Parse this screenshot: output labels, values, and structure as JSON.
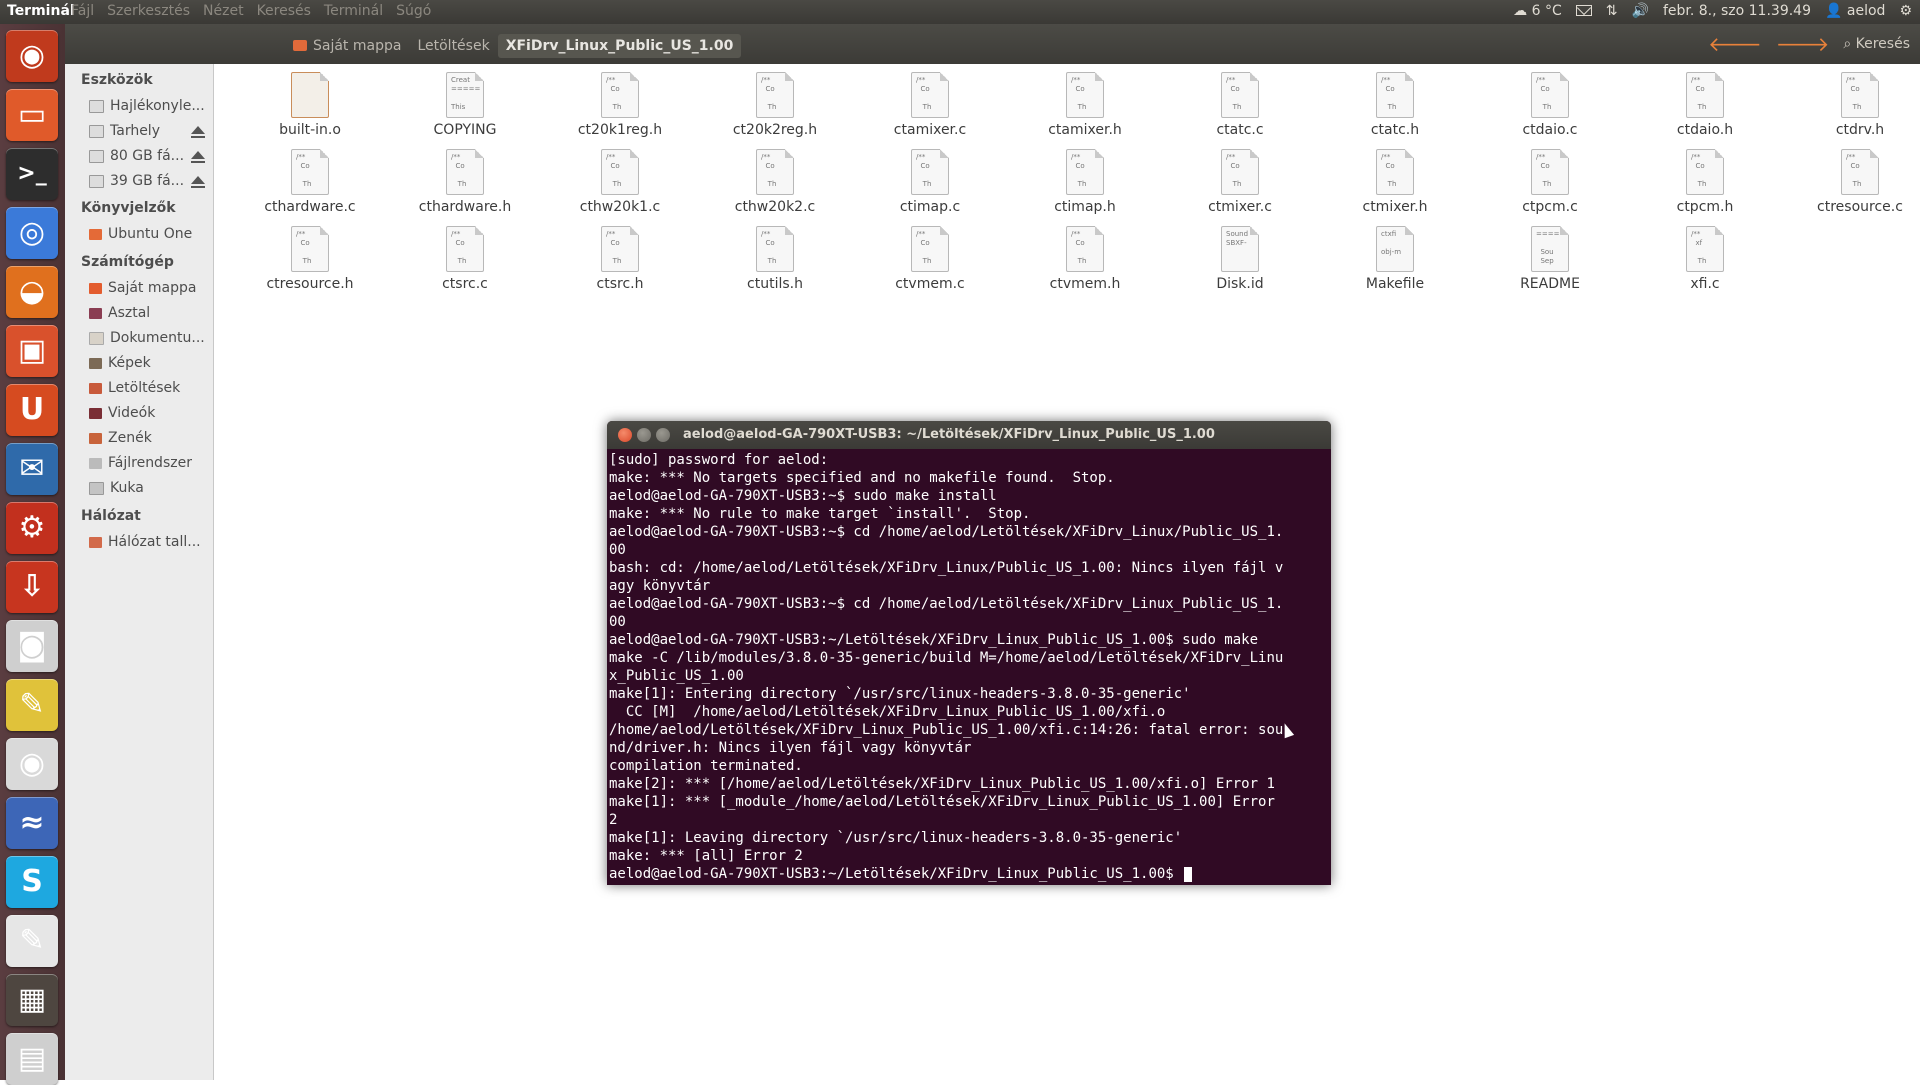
{
  "topbar": {
    "app_name": "Terminál",
    "menu": [
      "Fájl",
      "Szerkesztés",
      "Nézet",
      "Keresés",
      "Terminál",
      "Súgó"
    ],
    "weather": "6 °C",
    "datetime": "febr. 8., szo 11.39.49",
    "user": "aelod"
  },
  "launcher": {
    "items": [
      {
        "name": "dash-home",
        "color": "#c03a1d",
        "glyph": "◉"
      },
      {
        "name": "files",
        "color": "#e05a2a",
        "glyph": "▭"
      },
      {
        "name": "terminal",
        "color": "#2d2d2d",
        "glyph": ">_"
      },
      {
        "name": "chrome",
        "color": "#3b7ad9",
        "glyph": "◎"
      },
      {
        "name": "firefox",
        "color": "#e0701e",
        "glyph": "◒"
      },
      {
        "name": "software-center",
        "color": "#d9512c",
        "glyph": "▣"
      },
      {
        "name": "ubuntu-one",
        "color": "#d64b20",
        "glyph": "U"
      },
      {
        "name": "thunderbird",
        "color": "#2f6aaa",
        "glyph": "✉"
      },
      {
        "name": "system-settings",
        "color": "#c2301e",
        "glyph": "⚙"
      },
      {
        "name": "installer",
        "color": "#c7351f",
        "glyph": "⇩"
      },
      {
        "name": "camera",
        "color": "#cfcfcf",
        "glyph": "◙"
      },
      {
        "name": "sticky-notes",
        "color": "#e0c23a",
        "glyph": "✎"
      },
      {
        "name": "speaker",
        "color": "#d9d9d9",
        "glyph": "◉"
      },
      {
        "name": "messenger",
        "color": "#3d66b7",
        "glyph": "≈"
      },
      {
        "name": "skype",
        "color": "#1ea8e0",
        "glyph": "S"
      },
      {
        "name": "text-editor",
        "color": "#e6e6e6",
        "glyph": "✎"
      },
      {
        "name": "workspaces",
        "color": "#4e4640",
        "glyph": "▦"
      },
      {
        "name": "trash",
        "color": "#cfcfcf",
        "glyph": "▤"
      }
    ]
  },
  "nautilus": {
    "breadcrumb": [
      "Saját mappa",
      "Letöltések",
      "XFiDrv_Linux_Public_US_1.00"
    ],
    "search_label": "Keresés",
    "sidebar": {
      "devices_header": "Eszközök",
      "devices": [
        "Hajlékonyle...",
        "Tarhely",
        "80 GB fá...",
        "39 GB fá..."
      ],
      "bookmarks_header": "Könyvjelzők",
      "bookmarks": [
        "Ubuntu One"
      ],
      "computer_header": "Számítógép",
      "computer": [
        "Saját mappa",
        "Asztal",
        "Dokumentu...",
        "Képek",
        "Letöltések",
        "Videók",
        "Zenék",
        "Fájlrendszer",
        "Kuka"
      ],
      "network_header": "Hálózat",
      "network": [
        "Hálózat tall..."
      ]
    },
    "files": [
      {
        "name": "built-in.o",
        "preview": ""
      },
      {
        "name": "COPYING",
        "preview": "Creat\n=====\n\nThis"
      },
      {
        "name": "ct20k1reg.h",
        "preview": "/**  \n  Co\n\n   Th"
      },
      {
        "name": "ct20k2reg.h",
        "preview": "/**  \n  Co\n\n   Th"
      },
      {
        "name": "ctamixer.c",
        "preview": "/**  \n  Co\n\n   Th"
      },
      {
        "name": "ctamixer.h",
        "preview": "/**  \n  Co\n\n   Th"
      },
      {
        "name": "ctatc.c",
        "preview": "/**  \n  Co\n\n   Th"
      },
      {
        "name": "ctatc.h",
        "preview": "/**  \n  Co\n\n   Th"
      },
      {
        "name": "ctdaio.c",
        "preview": "/**  \n  Co\n\n   Th"
      },
      {
        "name": "ctdaio.h",
        "preview": "/**  \n  Co\n\n   Th"
      },
      {
        "name": "ctdrv.h",
        "preview": "/**  \n  Co\n\n   Th"
      },
      {
        "name": "cthardware.c",
        "preview": "/**  \n  Co\n\n   Th"
      },
      {
        "name": "cthardware.h",
        "preview": "/**  \n  Co\n\n   Th"
      },
      {
        "name": "cthw20k1.c",
        "preview": "/**  \n  Co\n\n   Th"
      },
      {
        "name": "cthw20k2.c",
        "preview": "/**  \n  Co\n\n   Th"
      },
      {
        "name": "ctimap.c",
        "preview": "/**  \n  Co\n\n   Th"
      },
      {
        "name": "ctimap.h",
        "preview": "/**  \n  Co\n\n   Th"
      },
      {
        "name": "ctmixer.c",
        "preview": "/**  \n  Co\n\n   Th"
      },
      {
        "name": "ctmixer.h",
        "preview": "/**  \n  Co\n\n   Th"
      },
      {
        "name": "ctpcm.c",
        "preview": "/**  \n  Co\n\n   Th"
      },
      {
        "name": "ctpcm.h",
        "preview": "/**  \n  Co\n\n   Th"
      },
      {
        "name": "ctresource.c",
        "preview": "/**  \n  Co\n\n   Th"
      },
      {
        "name": "ctresource.h",
        "preview": "/**  \n  Co\n\n   Th"
      },
      {
        "name": "ctsrc.c",
        "preview": "/**  \n  Co\n\n   Th"
      },
      {
        "name": "ctsrc.h",
        "preview": "/**  \n  Co\n\n   Th"
      },
      {
        "name": "ctutils.h",
        "preview": "/**  \n  Co\n\n   Th"
      },
      {
        "name": "ctvmem.c",
        "preview": "/**  \n  Co\n\n   Th"
      },
      {
        "name": "ctvmem.h",
        "preview": "/**  \n  Co\n\n   Th"
      },
      {
        "name": "Disk.id",
        "preview": "Sound\nSBXF-"
      },
      {
        "name": "Makefile",
        "preview": "ctxfi\n\nobj-m"
      },
      {
        "name": "README",
        "preview": "=====\n\n  Sou\n  Sep"
      },
      {
        "name": "xfi.c",
        "preview": "/**  \n  xf\n\n   Th"
      }
    ]
  },
  "terminal": {
    "title": "aelod@aelod-GA-790XT-USB3: ~/Letöltések/XFiDrv_Linux_Public_US_1.00",
    "lines": [
      "[sudo] password for aelod:",
      "make: *** No targets specified and no makefile found.  Stop.",
      "aelod@aelod-GA-790XT-USB3:~$ sudo make install",
      "make: *** No rule to make target `install'.  Stop.",
      "aelod@aelod-GA-790XT-USB3:~$ cd /home/aelod/Letöltések/XFiDrv_Linux/Public_US_1.",
      "00",
      "bash: cd: /home/aelod/Letöltések/XFiDrv_Linux/Public_US_1.00: Nincs ilyen fájl v",
      "agy könyvtár",
      "aelod@aelod-GA-790XT-USB3:~$ cd /home/aelod/Letöltések/XFiDrv_Linux_Public_US_1.",
      "00",
      "aelod@aelod-GA-790XT-USB3:~/Letöltések/XFiDrv_Linux_Public_US_1.00$ sudo make",
      "make -C /lib/modules/3.8.0-35-generic/build M=/home/aelod/Letöltések/XFiDrv_Linu",
      "x_Public_US_1.00",
      "make[1]: Entering directory `/usr/src/linux-headers-3.8.0-35-generic'",
      "  CC [M]  /home/aelod/Letöltések/XFiDrv_Linux_Public_US_1.00/xfi.o",
      "/home/aelod/Letöltések/XFiDrv_Linux_Public_US_1.00/xfi.c:14:26: fatal error: sou",
      "nd/driver.h: Nincs ilyen fájl vagy könyvtár",
      "compilation terminated.",
      "make[2]: *** [/home/aelod/Letöltések/XFiDrv_Linux_Public_US_1.00/xfi.o] Error 1",
      "make[1]: *** [_module_/home/aelod/Letöltések/XFiDrv_Linux_Public_US_1.00] Error",
      "2",
      "make[1]: Leaving directory `/usr/src/linux-headers-3.8.0-35-generic'",
      "make: *** [all] Error 2"
    ],
    "prompt": "aelod@aelod-GA-790XT-USB3:~/Letöltések/XFiDrv_Linux_Public_US_1.00$ "
  }
}
